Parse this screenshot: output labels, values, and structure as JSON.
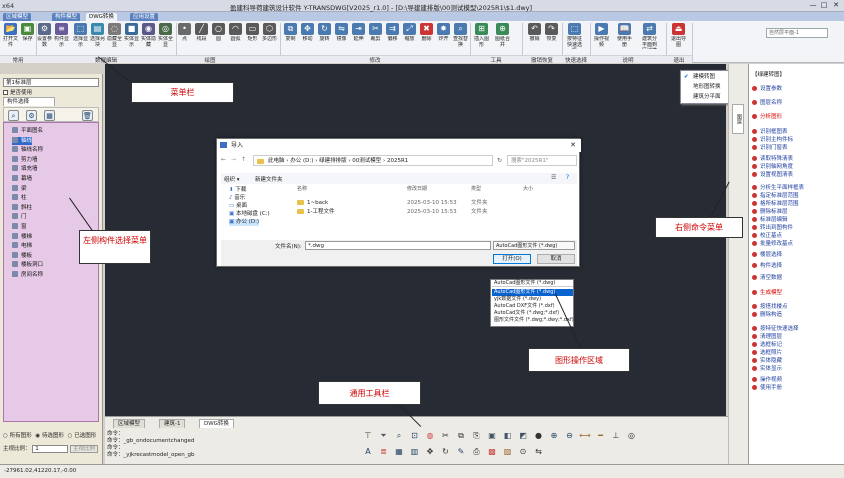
{
  "window": {
    "app": "x64",
    "title": "盈建科导荷建筑设计软件 Y-TRANSDWG[V2025_r1.0] - [D:\\导建建排版\\00测试模型\\2025R1\\$1.dwy]",
    "controls": [
      "—",
      "□",
      "✕"
    ]
  },
  "tabs": [
    "区域模型",
    "构件模型",
    "DWG转换",
    "应用设置"
  ],
  "ribbon": {
    "buttons": [
      {
        "label": "打开文件",
        "icon": "folder-open-icon",
        "color": "#3a6fc4"
      },
      {
        "label": "保存",
        "icon": "save-icon",
        "color": "#4a8a3a"
      },
      {
        "label": "设置参数",
        "icon": "settings-icon",
        "color": "#5a6a8a"
      },
      {
        "label": "构件显示",
        "icon": "layers-icon",
        "color": "#6a5a9a"
      },
      {
        "label": "选择显示",
        "icon": "select-icon",
        "color": "#4a7ab0"
      },
      {
        "label": "选择另块",
        "icon": "block-icon",
        "color": "#3a8ab0"
      },
      {
        "label": "隐藏全显",
        "icon": "hide-icon",
        "color": "#7a7a7a"
      },
      {
        "label": "实体显示",
        "icon": "solid-icon",
        "color": "#3a6a9a"
      },
      {
        "label": "实体隐藏",
        "icon": "eye-icon",
        "color": "#5a5a8a"
      },
      {
        "label": "实体全显",
        "icon": "show-all-icon",
        "color": "#4a6a4a"
      },
      {
        "label": "点",
        "icon": "point-icon",
        "color": "#6a6a6a"
      },
      {
        "label": "线段",
        "icon": "line-icon",
        "color": "#5a5a5a"
      },
      {
        "label": "圆",
        "icon": "circle-icon",
        "color": "#5a5a5a"
      },
      {
        "label": "圆弧",
        "icon": "arc-icon",
        "color": "#5a5a5a"
      },
      {
        "label": "矩形",
        "icon": "rect-icon",
        "color": "#5a5a5a"
      },
      {
        "label": "多边形",
        "icon": "polygon-icon",
        "color": "#5a5a5a"
      },
      {
        "label": "复制",
        "icon": "copy-icon",
        "color": "#4a7ab0"
      },
      {
        "label": "移动",
        "icon": "move-icon",
        "color": "#4a7ab0"
      },
      {
        "label": "旋转",
        "icon": "rotate-icon",
        "color": "#4a7ab0"
      },
      {
        "label": "镜像",
        "icon": "mirror-icon",
        "color": "#4a7ab0"
      },
      {
        "label": "延伸",
        "icon": "extend-icon",
        "color": "#4a7ab0"
      },
      {
        "label": "裁剪",
        "icon": "trim-icon",
        "color": "#4a7ab0"
      },
      {
        "label": "偏移",
        "icon": "offset-icon",
        "color": "#4a7ab0"
      },
      {
        "label": "缩放",
        "icon": "scale-icon",
        "color": "#4a7ab0"
      },
      {
        "label": "删除",
        "icon": "delete-icon",
        "color": "#c33"
      },
      {
        "label": "炸开",
        "icon": "explode-icon",
        "color": "#4a7ab0"
      },
      {
        "label": "查找替换",
        "icon": "find-icon",
        "color": "#4a7ab0"
      },
      {
        "label": "插入图形",
        "icon": "insert-icon",
        "color": "#3a8a5a"
      },
      {
        "label": "图纸合并",
        "icon": "merge-icon",
        "color": "#3a8a5a"
      },
      {
        "label": "撤销",
        "icon": "undo-icon",
        "color": "#5a5a5a"
      },
      {
        "label": "恢复",
        "icon": "redo-icon",
        "color": "#5a5a5a"
      },
      {
        "label": "按特征快速选择",
        "icon": "quick-select-icon",
        "color": "#4a7ab0"
      },
      {
        "label": "操作视频",
        "icon": "video-icon",
        "color": "#4a7ab0"
      },
      {
        "label": "使用手册",
        "icon": "manual-icon",
        "color": "#4a7ab0"
      },
      {
        "label": "建筑分平面到区域模型手份",
        "icon": "convert-icon",
        "color": "#4a7ab0"
      },
      {
        "label": "退出导图",
        "icon": "exit-icon",
        "color": "#c33"
      }
    ],
    "groups": [
      "常用",
      "数据编辑",
      "绘图",
      "修改",
      "工具",
      "撤销恢复",
      "快速选择",
      "说明",
      "退出"
    ],
    "view_combo": "自然层平面-1"
  },
  "view_dropdown": {
    "items": [
      "建模转图",
      "地形图转换",
      "建筑分平面"
    ],
    "checked_index": 0
  },
  "left_panel": {
    "combo": "第1标准层",
    "checkbox": "是否使用",
    "tab": "构件选择",
    "items": [
      "平面图名",
      "轴线",
      "轴线名称",
      "剪力墙",
      "填充墙",
      "幕墙",
      "梁",
      "柱",
      "斜柱",
      "门",
      "窗",
      "楼梯",
      "电梯",
      "楼板",
      "楼板洞口",
      "房间名称"
    ],
    "selected": 1,
    "radios": [
      "所有图形",
      "待选图形",
      "已选图形"
    ],
    "ratio_label": "主视比例：",
    "ratio_value": "1",
    "apply_button": "主视比例"
  },
  "right_panel": {
    "header": "【绿建转图】",
    "items": [
      {
        "text": "设置参数",
        "style": "link"
      },
      {
        "text": "图层名称",
        "style": "link"
      },
      {
        "text": "分析图形",
        "style": "red"
      },
      {
        "text": "识别框图表",
        "style": "link"
      },
      {
        "text": "识别主构件标",
        "style": "link"
      },
      {
        "text": "识别门窗表",
        "style": "link"
      },
      {
        "text": "读取特殊清表",
        "style": "link"
      },
      {
        "text": "识别轴网角度",
        "style": "link"
      },
      {
        "text": "设置视图清表",
        "style": "link"
      },
      {
        "text": "分析生平面样框表",
        "style": "link"
      },
      {
        "text": "指定标准层范围",
        "style": "link"
      },
      {
        "text": "格所标准层范围",
        "style": "link"
      },
      {
        "text": "删除标准层",
        "style": "link"
      },
      {
        "text": "标准层编辑",
        "style": "link"
      },
      {
        "text": "转出到图构件",
        "style": "link"
      },
      {
        "text": "校正基点",
        "style": "link"
      },
      {
        "text": "批量修改基点",
        "style": "link"
      },
      {
        "text": "楼层选择",
        "style": "link"
      },
      {
        "text": "构件选择",
        "style": "link"
      },
      {
        "text": "清空数据",
        "style": "link"
      },
      {
        "text": "生成模型",
        "style": "red"
      },
      {
        "text": "按搭找楼点",
        "style": "link"
      },
      {
        "text": "删除构造",
        "style": "link"
      },
      {
        "text": "按特征快速选择",
        "style": "link"
      },
      {
        "text": "清理图层",
        "style": "link"
      },
      {
        "text": "选框标记",
        "style": "link"
      },
      {
        "text": "选框照片",
        "style": "link"
      },
      {
        "text": "实体隐藏",
        "style": "link"
      },
      {
        "text": "实体显示",
        "style": "link"
      },
      {
        "text": "操作视频",
        "style": "link"
      },
      {
        "text": "使用手册",
        "style": "link"
      }
    ]
  },
  "dialog": {
    "title": "导入",
    "breadcrumb": [
      "此电脑",
      "办公 (D:)",
      "绿建排排版",
      "00测试模型",
      "2025R1"
    ],
    "search_placeholder": "搜索\"2025R1\"",
    "organize": "组织 ▾",
    "new_folder": "新建文件夹",
    "nav": [
      "下载",
      "音乐",
      "桌面",
      "本地磁盘 (C:)",
      "办公 (D:)"
    ],
    "columns": [
      "名称",
      "修改日期",
      "类型",
      "大小"
    ],
    "files": [
      {
        "name": "1~back",
        "date": "2025-03-10 15:53",
        "type": "文件夹"
      },
      {
        "name": "1-工程文件",
        "date": "2025-03-10 15:53",
        "type": "文件夹"
      }
    ],
    "filename_label": "文件名(N):",
    "filename_value": "*.dwg",
    "filetype": "AutoCad图形文件 (*.dwg)",
    "open": "打开(O)",
    "cancel": "取消"
  },
  "filetype_dropdown": {
    "header": "AutoCad图形文件 (*.dwg)",
    "items": [
      "AutoCad图形文件 (*.dwg)",
      "yjk数据文件 (*.dwy)",
      "AutoCad DXF文件 (*.dxf)",
      "AutoCad文件 (*.dwg;*.dxf)",
      "图形文件文件 (*.dwg;*.dwy;*.dxf)"
    ],
    "selected": 0
  },
  "bottom": {
    "tabs": [
      "区域模型",
      "建筑-1",
      "DWG转换"
    ],
    "active_tab": 2,
    "commands": [
      "命令：",
      "命令：_gb_ondocumentchanged",
      "命令：",
      "命令：_yjkrecastmodel_open_gb"
    ]
  },
  "status": {
    "coords": "-27961.02,41220.17,-0.00"
  },
  "annotations": {
    "menu": "菜单栏",
    "left": "左侧构件选择菜单",
    "right": "右侧命令菜单",
    "canvas": "图形操作区域",
    "toolbar": "通用工具栏"
  },
  "toolbar_icons": [
    "filter-icon",
    "funnel-icon",
    "zoom-icon",
    "zoom-window-icon",
    "color-icon",
    "cut-icon",
    "copy-icon",
    "paste-icon",
    "cube-icon",
    "box-icon",
    "view-icon",
    "sphere-icon",
    "zoom-in-icon",
    "zoom-out-icon",
    "measure-icon",
    "ruler-icon",
    "axis-icon",
    "compass-icon",
    "text-icon",
    "layer-icon",
    "table-icon",
    "chart-icon",
    "move-icon",
    "rotate-icon",
    "pen-icon",
    "print-icon",
    "grid-icon",
    "hatch-icon",
    "snap-icon",
    "align-icon"
  ]
}
